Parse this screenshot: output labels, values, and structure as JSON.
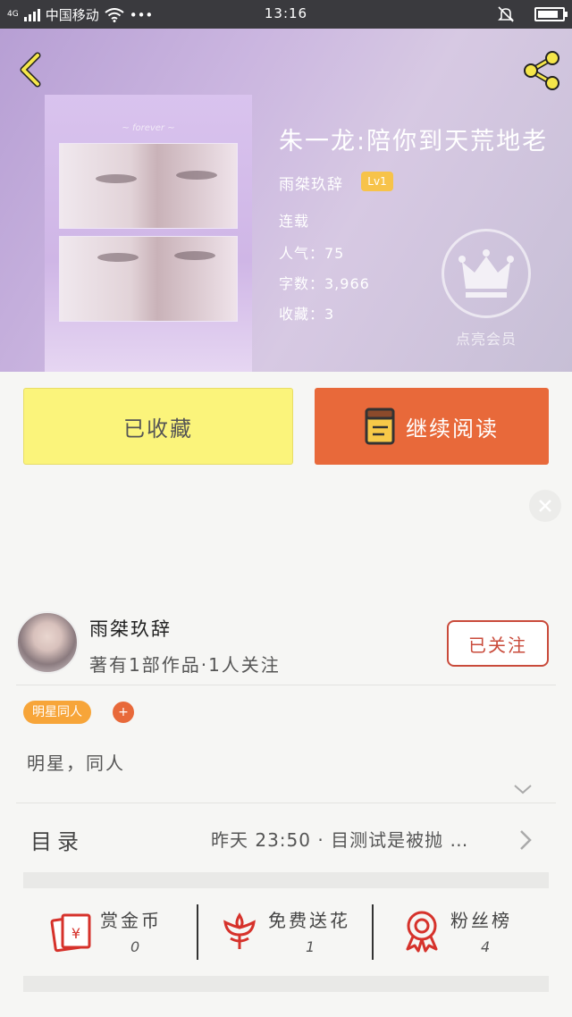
{
  "status_bar": {
    "network": "4G",
    "carrier": "中国移动",
    "more": "•••",
    "time": "13:16"
  },
  "icons": {
    "back": "chevron-left-icon",
    "share": "share-icon",
    "vip": "crown-icon",
    "book": "book-icon",
    "close": "close-icon",
    "reward": "red-envelope-icon",
    "flower": "flower-icon",
    "fans": "medal-icon"
  },
  "book": {
    "title": "朱一龙:陪你到天荒地老",
    "author": "雨桀玖辞",
    "level": "Lv1",
    "cover_tagline": "~ forever ~",
    "status": "连载",
    "popularity": "人气：75",
    "word_count": "字数：3,966",
    "favorites": "收藏：3"
  },
  "vip": {
    "label": "点亮会员"
  },
  "actions": {
    "favorited_label": "已收藏",
    "continue_label": "继续阅读"
  },
  "author_row": {
    "name": "雨桀玖辞",
    "stats": "著有1部作品·1人关注",
    "follow_label": "已关注"
  },
  "tags": {
    "pill": "明星同人",
    "add": "+",
    "text": "明星，同人"
  },
  "toc": {
    "label": "目录",
    "latest": "昨天 23:50 · 目测试是被抛 …"
  },
  "stats": [
    {
      "label": "赏金币",
      "value": "0"
    },
    {
      "label": "免费送花",
      "value": "1"
    },
    {
      "label": "粉丝榜",
      "value": "4"
    }
  ],
  "colors": {
    "accent_orange": "#e8693a",
    "fav_yellow": "#fbf47b",
    "tag_orange": "#f7a539",
    "follow_red": "#c94a3a",
    "level_gold": "#f7c34a"
  }
}
